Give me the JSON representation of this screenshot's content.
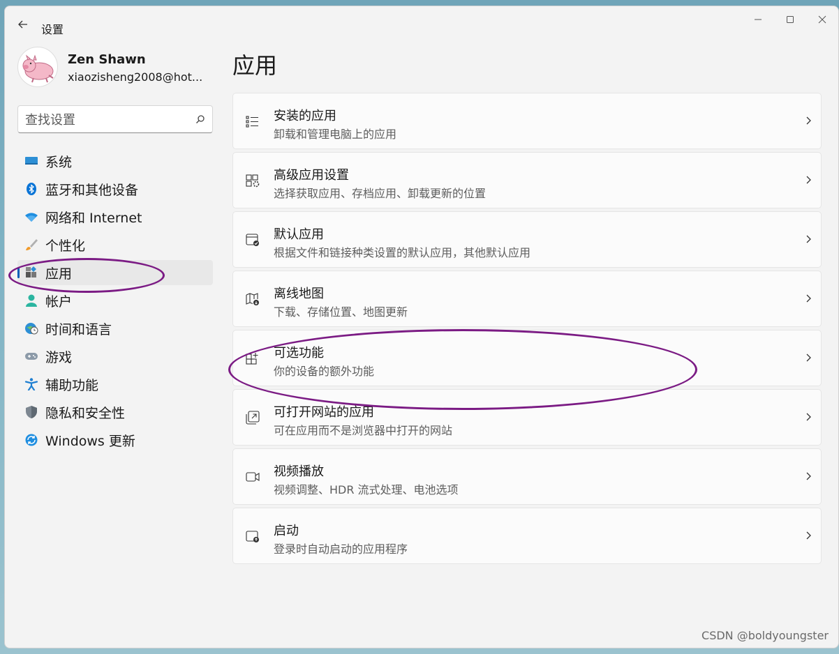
{
  "window": {
    "title": "设置"
  },
  "profile": {
    "name": "Zen Shawn",
    "email": "xiaozisheng2008@hot..."
  },
  "search": {
    "placeholder": "查找设置"
  },
  "nav": {
    "items": [
      {
        "label": "系统",
        "icon": "system-icon"
      },
      {
        "label": "蓝牙和其他设备",
        "icon": "bluetooth-icon"
      },
      {
        "label": "网络和 Internet",
        "icon": "wifi-icon"
      },
      {
        "label": "个性化",
        "icon": "brush-icon"
      },
      {
        "label": "应用",
        "icon": "apps-icon",
        "active": true
      },
      {
        "label": "帐户",
        "icon": "account-icon"
      },
      {
        "label": "时间和语言",
        "icon": "globe-clock-icon"
      },
      {
        "label": "游戏",
        "icon": "gamepad-icon"
      },
      {
        "label": "辅助功能",
        "icon": "accessibility-icon"
      },
      {
        "label": "隐私和安全性",
        "icon": "shield-icon"
      },
      {
        "label": "Windows 更新",
        "icon": "update-icon"
      }
    ]
  },
  "main": {
    "title": "应用",
    "cards": [
      {
        "title": "安装的应用",
        "subtitle": "卸载和管理电脑上的应用",
        "icon": "list-icon"
      },
      {
        "title": "高级应用设置",
        "subtitle": "选择获取应用、存档应用、卸载更新的位置",
        "icon": "app-settings-icon"
      },
      {
        "title": "默认应用",
        "subtitle": "根据文件和链接种类设置的默认应用，其他默认应用",
        "icon": "default-apps-icon"
      },
      {
        "title": "离线地图",
        "subtitle": "下载、存储位置、地图更新",
        "icon": "map-download-icon"
      },
      {
        "title": "可选功能",
        "subtitle": "你的设备的额外功能",
        "icon": "optional-features-icon"
      },
      {
        "title": "可打开网站的应用",
        "subtitle": "可在应用而不是浏览器中打开的网站",
        "icon": "open-web-icon"
      },
      {
        "title": "视频播放",
        "subtitle": "视频调整、HDR 流式处理、电池选项",
        "icon": "video-icon"
      },
      {
        "title": "启动",
        "subtitle": "登录时自动启动的应用程序",
        "icon": "startup-icon"
      }
    ]
  },
  "colors": {
    "accent": "#005fb8",
    "annotation": "#7b1b84",
    "window_bg": "#f3f3f3",
    "card_bg": "#fbfbfb"
  },
  "watermark": "CSDN @boldyoungster"
}
